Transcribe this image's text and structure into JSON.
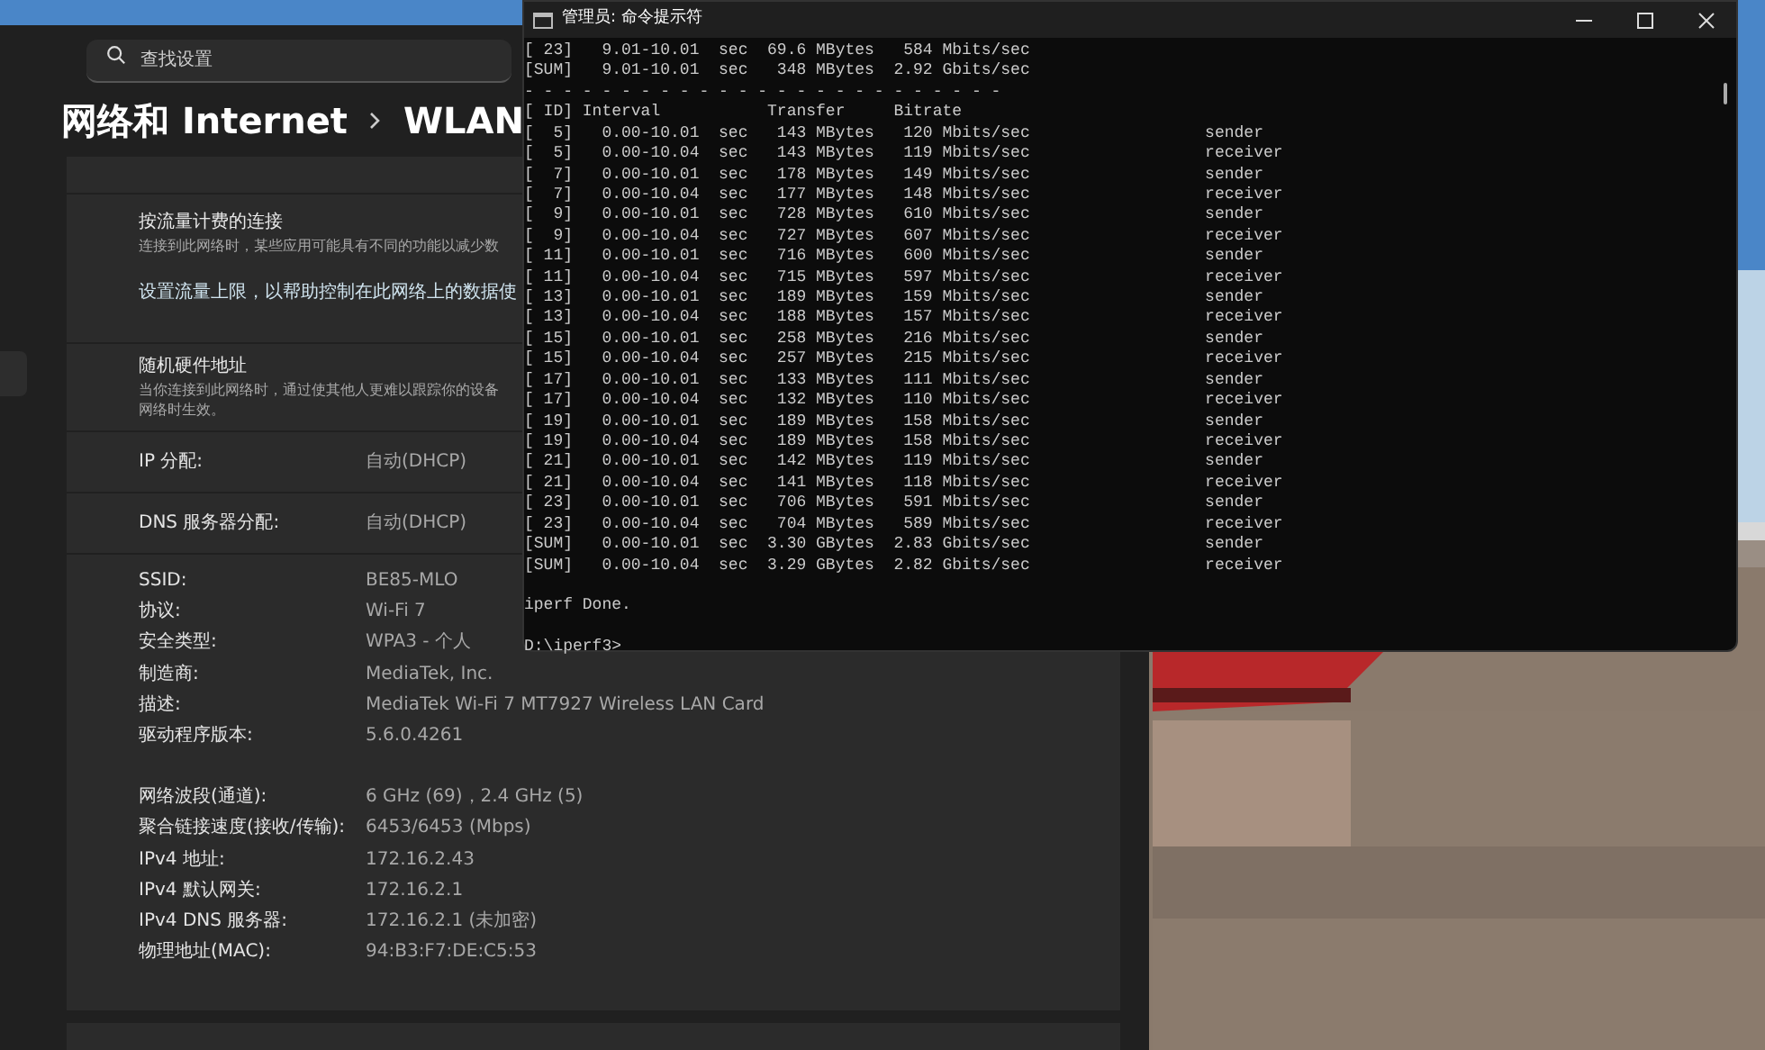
{
  "settings": {
    "search": {
      "placeholder": "查找设置"
    },
    "breadcrumb": [
      "网络和 Internet",
      "WLAN"
    ],
    "metered": {
      "title": "按流量计费的连接",
      "description": "连接到此网络时，某些应用可能具有不同的功能以减少数",
      "link": "设置流量上限，以帮助控制在此网络上的数据使"
    },
    "random_mac": {
      "title": "随机硬件地址",
      "description": "当你连接到此网络时，通过使其他人更难以跟踪你的设备",
      "description_2": "网络时生效。"
    },
    "ip_rows": [
      {
        "label": "IP 分配:",
        "value": "自动(DHCP)"
      },
      {
        "label": "DNS 服务器分配:",
        "value": "自动(DHCP)"
      }
    ],
    "properties": [
      {
        "label": "SSID:",
        "value": "BE85-MLO"
      },
      {
        "label": "协议:",
        "value": "Wi-Fi 7"
      },
      {
        "label": "安全类型:",
        "value": "WPA3 - 个人"
      },
      {
        "label": "制造商:",
        "value": "MediaTek, Inc."
      },
      {
        "label": "描述:",
        "value": "MediaTek Wi-Fi 7 MT7927 Wireless LAN Card"
      },
      {
        "label": "驱动程序版本:",
        "value": "5.6.0.4261"
      }
    ],
    "properties_2": [
      {
        "label": "网络波段(通道):",
        "value": "6 GHz (69)，2.4 GHz (5)"
      },
      {
        "label": "聚合链接速度(接收/传输):",
        "value": "6453/6453 (Mbps)"
      },
      {
        "label": "IPv4 地址:",
        "value": "172.16.2.43"
      },
      {
        "label": "IPv4 默认网关:",
        "value": "172.16.2.1"
      },
      {
        "label": "IPv4 DNS 服务器:",
        "value": "172.16.2.1 (未加密)"
      },
      {
        "label": "物理地址(MAC):",
        "value": "94:B3:F7:DE:C5:53"
      }
    ]
  },
  "terminal": {
    "title": "管理员: 命令提示符",
    "output": [
      "[ 23]   9.01-10.01  sec  69.6 MBytes   584 Mbits/sec",
      "[SUM]   9.01-10.01  sec   348 MBytes  2.92 Gbits/sec",
      "- - - - - - - - - - - - - - - - - - - - - - - - -",
      "[ ID] Interval           Transfer     Bitrate",
      "[  5]   0.00-10.01  sec   143 MBytes   120 Mbits/sec                  sender",
      "[  5]   0.00-10.04  sec   143 MBytes   119 Mbits/sec                  receiver",
      "[  7]   0.00-10.01  sec   178 MBytes   149 Mbits/sec                  sender",
      "[  7]   0.00-10.04  sec   177 MBytes   148 Mbits/sec                  receiver",
      "[  9]   0.00-10.01  sec   728 MBytes   610 Mbits/sec                  sender",
      "[  9]   0.00-10.04  sec   727 MBytes   607 Mbits/sec                  receiver",
      "[ 11]   0.00-10.01  sec   716 MBytes   600 Mbits/sec                  sender",
      "[ 11]   0.00-10.04  sec   715 MBytes   597 Mbits/sec                  receiver",
      "[ 13]   0.00-10.01  sec   189 MBytes   159 Mbits/sec                  sender",
      "[ 13]   0.00-10.04  sec   188 MBytes   157 Mbits/sec                  receiver",
      "[ 15]   0.00-10.01  sec   258 MBytes   216 Mbits/sec                  sender",
      "[ 15]   0.00-10.04  sec   257 MBytes   215 Mbits/sec                  receiver",
      "[ 17]   0.00-10.01  sec   133 MBytes   111 Mbits/sec                  sender",
      "[ 17]   0.00-10.04  sec   132 MBytes   110 Mbits/sec                  receiver",
      "[ 19]   0.00-10.01  sec   189 MBytes   158 Mbits/sec                  sender",
      "[ 19]   0.00-10.04  sec   189 MBytes   158 Mbits/sec                  receiver",
      "[ 21]   0.00-10.01  sec   142 MBytes   119 Mbits/sec                  sender",
      "[ 21]   0.00-10.04  sec   141 MBytes   118 Mbits/sec                  receiver",
      "[ 23]   0.00-10.01  sec   706 MBytes   591 Mbits/sec                  sender",
      "[ 23]   0.00-10.04  sec   704 MBytes   589 Mbits/sec                  receiver",
      "[SUM]   0.00-10.01  sec  3.30 GBytes  2.83 Gbits/sec                  sender",
      "[SUM]   0.00-10.04  sec  3.29 GBytes  2.82 Gbits/sec                  receiver"
    ],
    "status": "iperf Done.",
    "prompt": "D:\\iperf3>"
  }
}
